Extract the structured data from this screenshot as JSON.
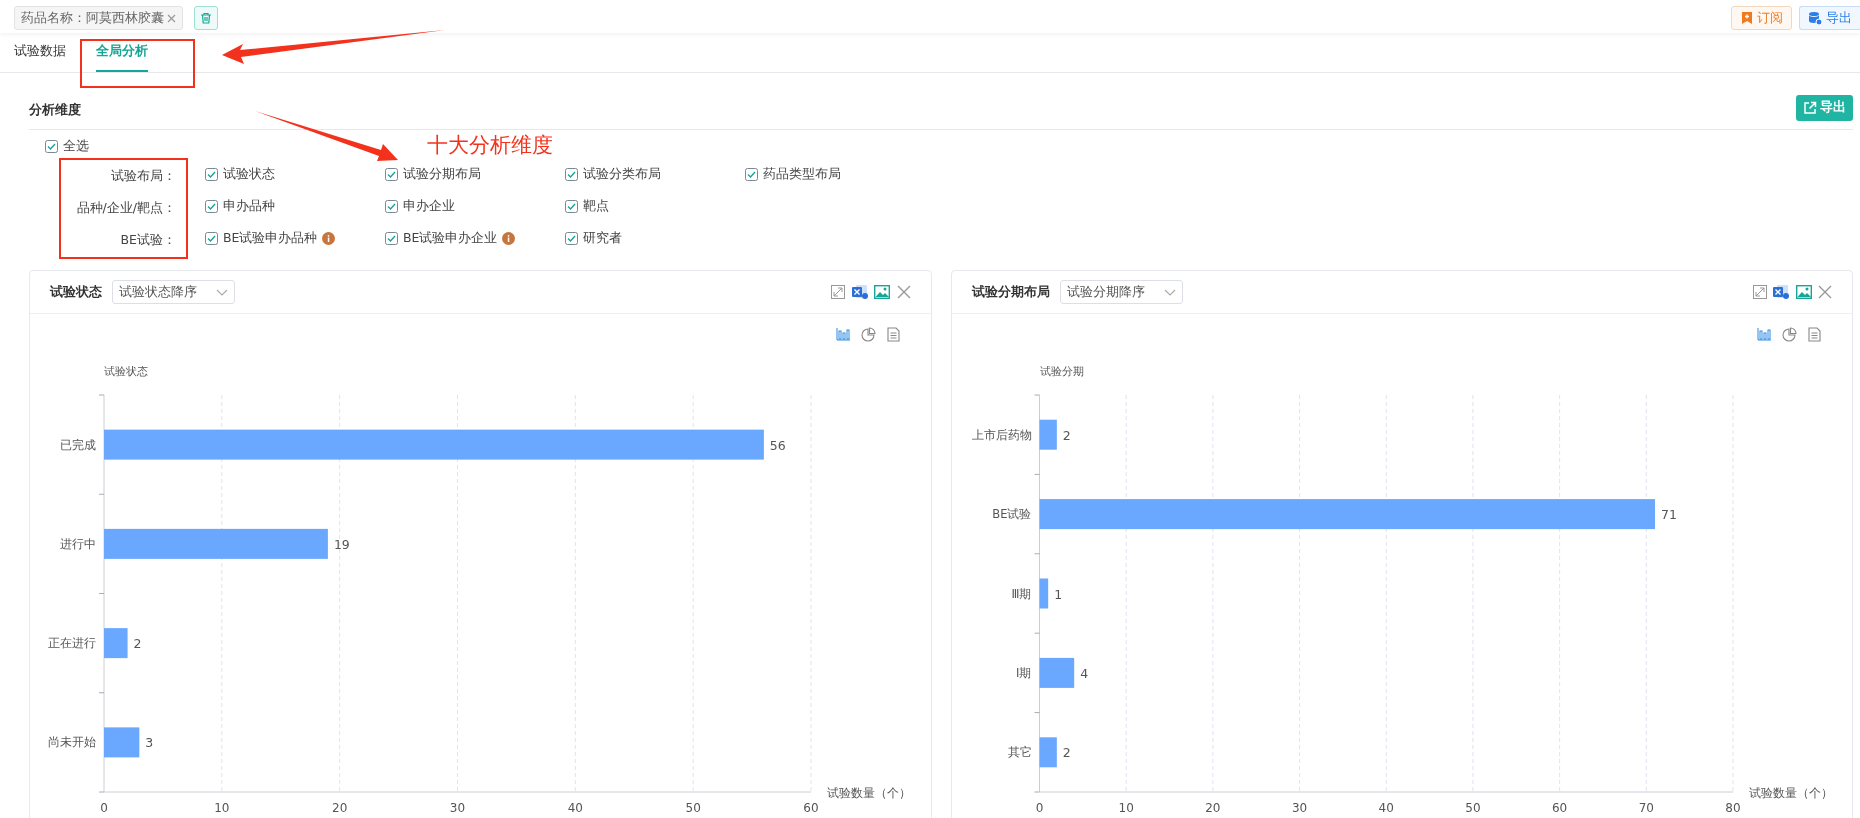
{
  "filter_tag": {
    "label": "药品名称：阿莫西林胶囊"
  },
  "top_buttons": [
    {
      "kind": "subscribe",
      "label": "订阅"
    },
    {
      "kind": "export",
      "label": "导出"
    }
  ],
  "tabs": [
    {
      "label": "试验数据",
      "selected": false
    },
    {
      "label": "全局分析",
      "selected": true
    }
  ],
  "section": {
    "title": "分析维度",
    "export_label": "导出"
  },
  "select_all": {
    "label": "全选",
    "checked": true
  },
  "dimension_groups": [
    {
      "label": "试验布局：",
      "options": [
        {
          "label": "试验状态",
          "checked": true
        },
        {
          "label": "试验分期布局",
          "checked": true
        },
        {
          "label": "试验分类布局",
          "checked": true
        },
        {
          "label": "药品类型布局",
          "checked": true
        }
      ]
    },
    {
      "label": "品种/企业/靶点：",
      "options": [
        {
          "label": "申办品种",
          "checked": true
        },
        {
          "label": "申办企业",
          "checked": true
        },
        {
          "label": "靶点",
          "checked": true
        }
      ]
    },
    {
      "label": "BE试验：",
      "options": [
        {
          "label": "BE试验申办品种",
          "checked": true,
          "info": true
        },
        {
          "label": "BE试验申办企业",
          "checked": true,
          "info": true
        },
        {
          "label": "研究者",
          "checked": true
        }
      ]
    }
  ],
  "annotation": {
    "caption": "十大分析维度"
  },
  "charts": [
    {
      "title": "试验状态",
      "sort": "试验状态降序",
      "views": [
        {
          "kind": "bar",
          "selected": true
        },
        {
          "kind": "pie",
          "selected": false
        },
        {
          "kind": "table",
          "selected": false
        }
      ],
      "chart_data": {
        "type": "bar",
        "orientation": "horizontal",
        "ylabel": "试验状态",
        "xlabel": "试验数量（个）",
        "categories": [
          "已完成",
          "进行中",
          "正在进行",
          "尚未开始"
        ],
        "values": [
          56,
          19,
          2,
          3
        ],
        "grid": true,
        "xlim": [
          0,
          60
        ],
        "xticks": [
          0,
          10,
          20,
          30,
          40,
          50,
          60
        ],
        "data_labels": true
      }
    },
    {
      "title": "试验分期布局",
      "sort": "试验分期降序",
      "views": [
        {
          "kind": "bar",
          "selected": true
        },
        {
          "kind": "pie",
          "selected": false
        },
        {
          "kind": "table",
          "selected": false
        }
      ],
      "chart_data": {
        "type": "bar",
        "orientation": "horizontal",
        "ylabel": "试验分期",
        "xlabel": "试验数量（个）",
        "categories": [
          "上市后药物",
          "BE试验",
          "Ⅲ期",
          "Ⅰ期",
          "其它"
        ],
        "values": [
          2,
          71,
          1,
          4,
          2
        ],
        "grid": true,
        "xlim": [
          0,
          80
        ],
        "xticks": [
          0,
          10,
          20,
          30,
          40,
          50,
          60,
          70,
          80
        ],
        "data_labels": true
      }
    }
  ]
}
